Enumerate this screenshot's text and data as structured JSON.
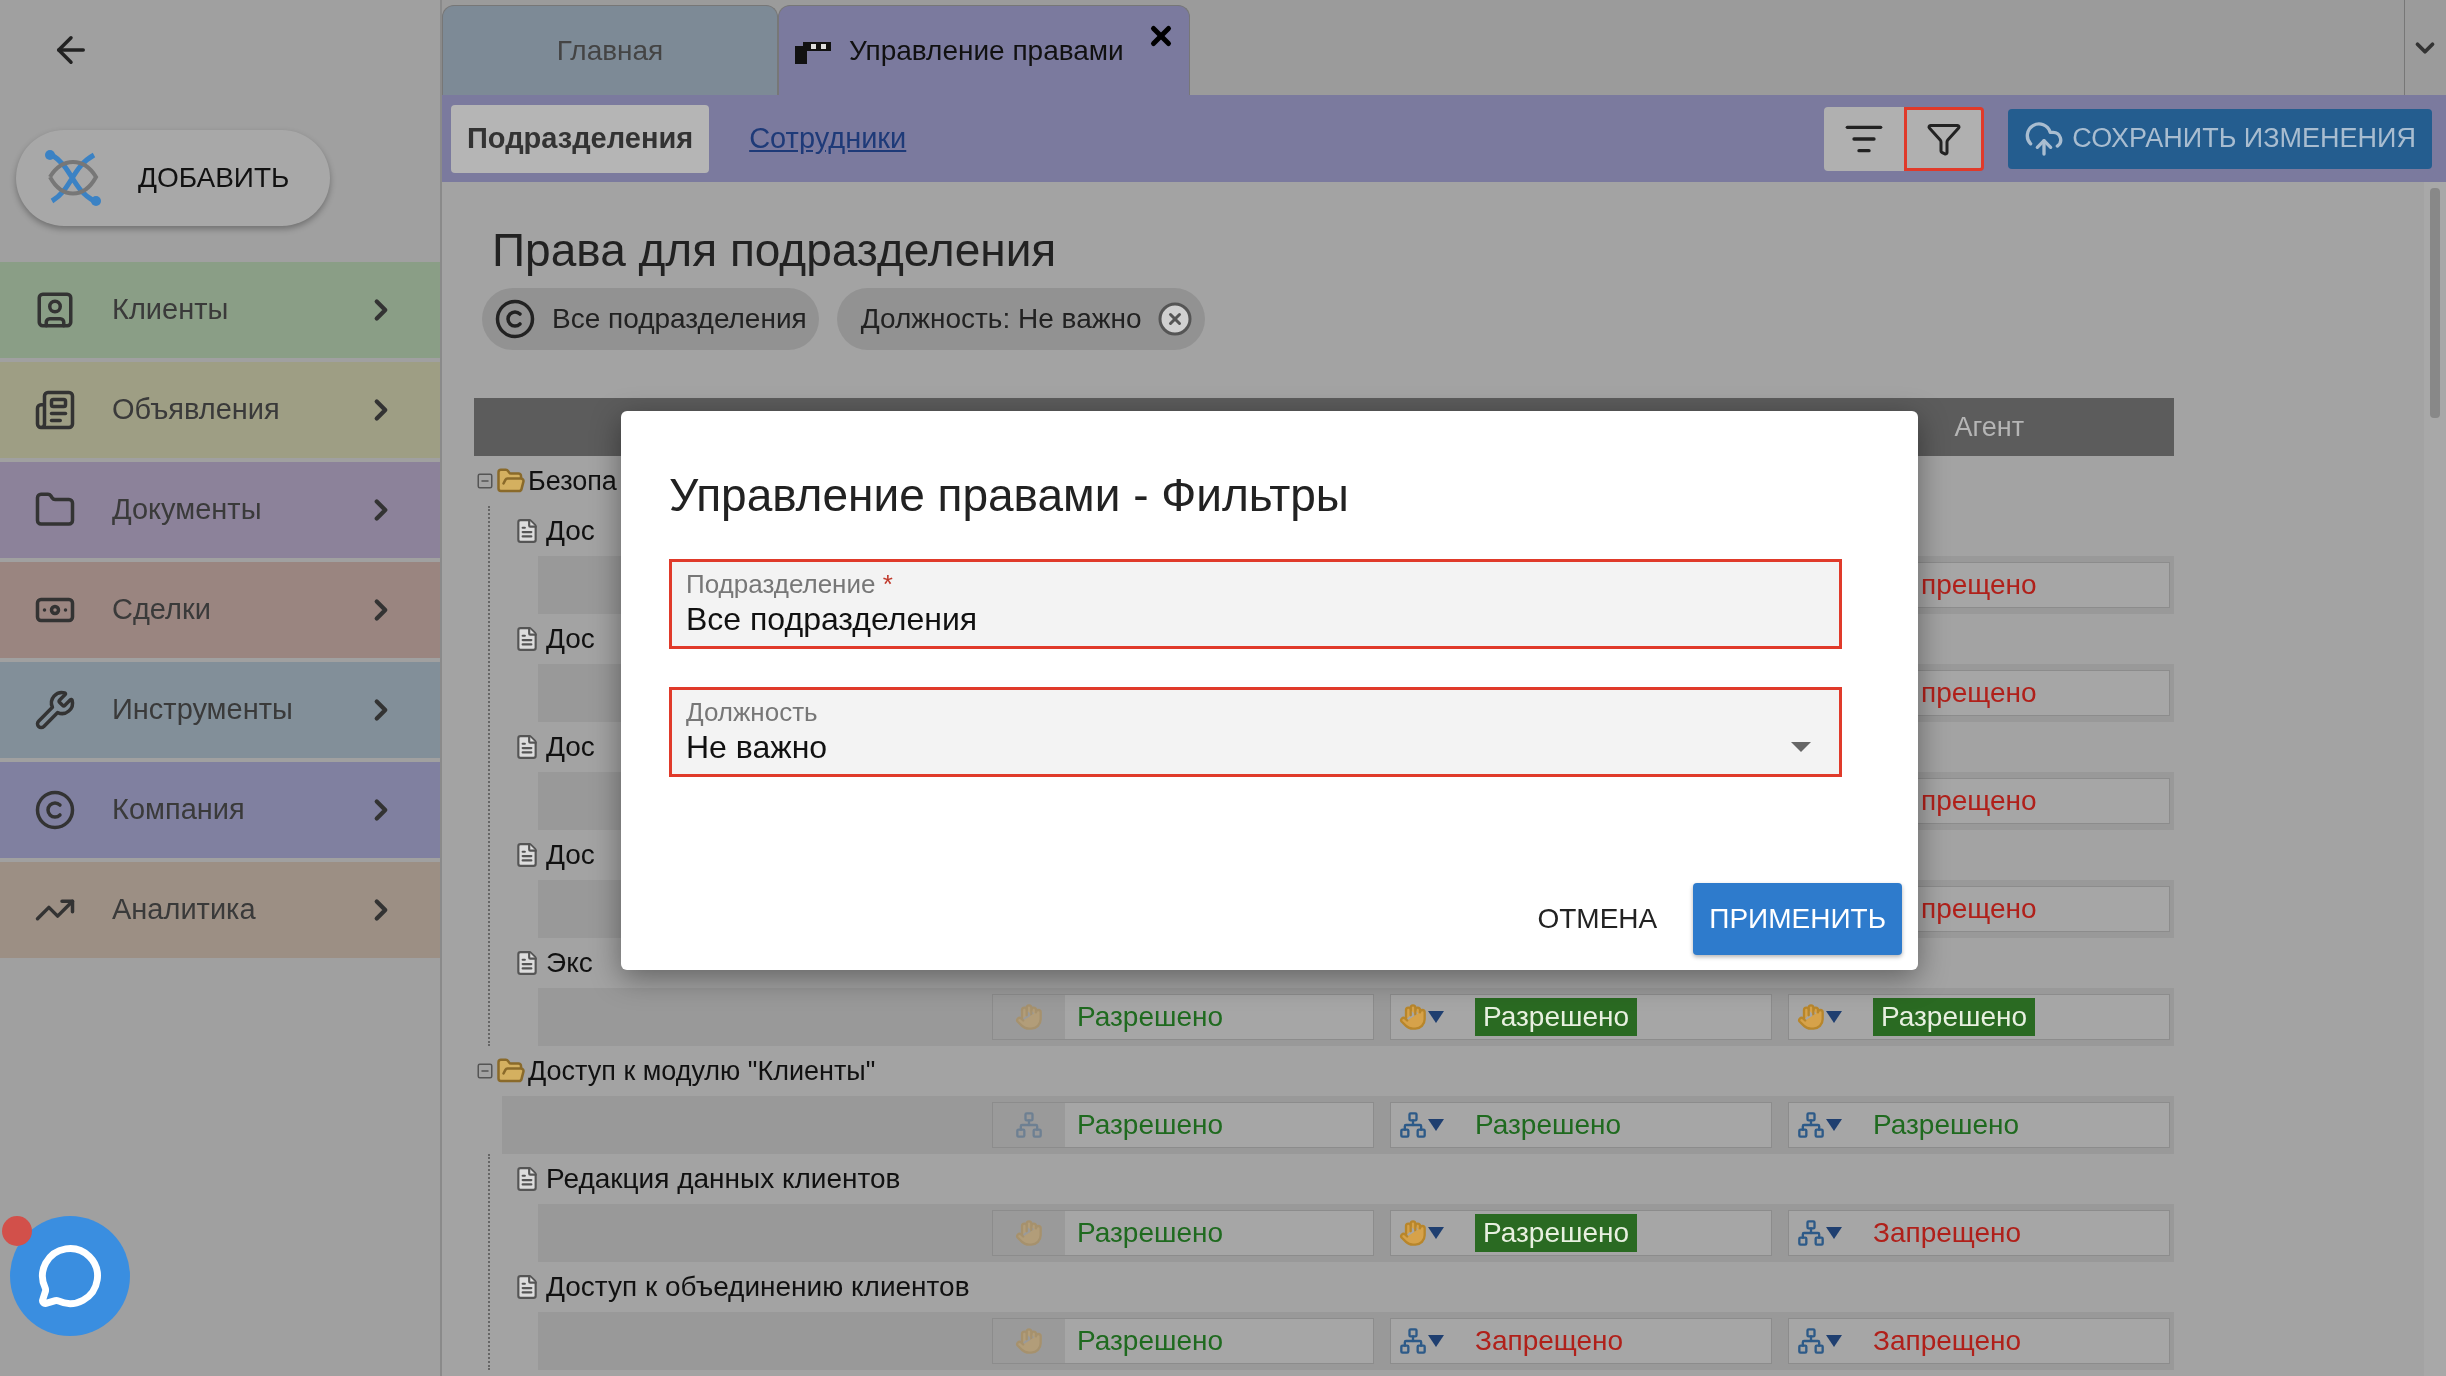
{
  "sidebar": {
    "add_button": "ДОБАВИТЬ",
    "items": [
      {
        "label": "Клиенты",
        "color": "#8a9e86"
      },
      {
        "label": "Объявления",
        "color": "#9e9e84"
      },
      {
        "label": "Документы",
        "color": "#8c829a"
      },
      {
        "label": "Сделки",
        "color": "#9a8580"
      },
      {
        "label": "Инструменты",
        "color": "#828f99"
      },
      {
        "label": "Компания",
        "color": "#8080a0"
      },
      {
        "label": "Аналитика",
        "color": "#9c8f84"
      }
    ]
  },
  "tabs": [
    {
      "label": "Главная",
      "selected": false
    },
    {
      "label": "Управление правами",
      "selected": true
    }
  ],
  "subtabs": [
    {
      "label": "Подразделения",
      "selected": true
    },
    {
      "label": "Сотрудники",
      "selected": false
    }
  ],
  "save_button": "СОХРАНИТЬ ИЗМЕНЕНИЯ",
  "page_title": "Права для подразделения",
  "chips": [
    {
      "label": "Все подразделения",
      "kind": "scope"
    },
    {
      "label": "Должность: Не важно",
      "kind": "removable"
    }
  ],
  "table": {
    "column_4": "Агент",
    "tree": [
      {
        "label": "Безопа",
        "expanded": true,
        "children": [
          {
            "label": "Дос",
            "permissions": [
              {
                "kind": "covered",
                "text": "прещено",
                "allowed": false
              }
            ]
          },
          {
            "label": "Дос",
            "permissions": [
              {
                "kind": "covered",
                "text": "прещено",
                "allowed": false
              }
            ]
          },
          {
            "label": "Дос",
            "permissions": [
              {
                "kind": "covered",
                "text": "прещено",
                "allowed": false
              }
            ]
          },
          {
            "label": "Дос",
            "permissions": [
              {
                "kind": "covered",
                "text": "прещено",
                "allowed": false
              }
            ]
          },
          {
            "label": "Экс",
            "permissions": [
              {
                "kind": "hand",
                "text": "Разрешено",
                "allowed": true,
                "highlighted": false
              },
              {
                "kind": "hand",
                "text": "Разрешено",
                "allowed": true,
                "highlighted": true
              },
              {
                "kind": "hand",
                "text": "Разрешено",
                "allowed": true,
                "highlighted": true
              }
            ]
          }
        ]
      },
      {
        "label": "Доступ к модулю \"Клиенты\"",
        "expanded": true,
        "permissions": [
          {
            "kind": "network",
            "text": "Разрешено",
            "allowed": true,
            "highlighted": false
          },
          {
            "kind": "network",
            "text": "Разрешено",
            "allowed": true,
            "highlighted": false
          },
          {
            "kind": "network",
            "text": "Разрешено",
            "allowed": true,
            "highlighted": false
          }
        ],
        "children": [
          {
            "label": "Редакция данных клиентов",
            "permissions": [
              {
                "kind": "hand",
                "text": "Разрешено",
                "allowed": true,
                "highlighted": false
              },
              {
                "kind": "hand",
                "text": "Разрешено",
                "allowed": true,
                "highlighted": true
              },
              {
                "kind": "network",
                "text": "Запрещено",
                "allowed": false,
                "highlighted": false
              }
            ]
          },
          {
            "label": "Доступ к объединению клиентов",
            "permissions": [
              {
                "kind": "hand",
                "text": "Разрешено",
                "allowed": true,
                "highlighted": false
              },
              {
                "kind": "network",
                "text": "Запрещено",
                "allowed": false,
                "highlighted": false
              },
              {
                "kind": "network",
                "text": "Запрещено",
                "allowed": false,
                "highlighted": false
              }
            ]
          }
        ]
      }
    ]
  },
  "dialog": {
    "title": "Управление правами - Фильтры",
    "fields": [
      {
        "label": "Подразделение",
        "required_mark": "*",
        "value": "Все подразделения",
        "kind": "text"
      },
      {
        "label": "Должность",
        "value": "Не важно",
        "kind": "select"
      }
    ],
    "buttons": [
      {
        "label": "ОТМЕНА",
        "kind": "text"
      },
      {
        "label": "ПРИМЕНИТЬ",
        "kind": "primary"
      }
    ]
  },
  "chat": {
    "unread": true
  }
}
